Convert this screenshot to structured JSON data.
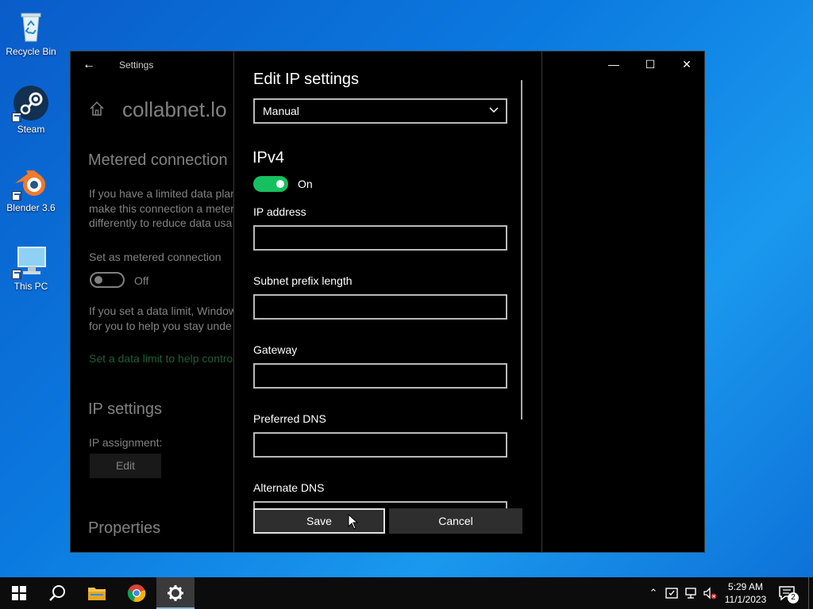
{
  "desktop": {
    "icons": [
      {
        "label": "Recycle Bin",
        "icon": "recycle-bin-icon"
      },
      {
        "label": "Steam",
        "icon": "steam-icon"
      },
      {
        "label": "Blender 3.6",
        "icon": "blender-icon"
      },
      {
        "label": "This PC",
        "icon": "computer-icon"
      }
    ]
  },
  "window": {
    "app_title": "Settings",
    "controls": {
      "minimize": "—",
      "maximize": "☐",
      "close": "✕"
    }
  },
  "background_page": {
    "heading": "collabnet.lo",
    "metered": {
      "heading": "Metered connection",
      "desc_lines": [
        "If you have a limited data plan",
        "make this connection a metere",
        "differently to reduce data usa"
      ],
      "set_label": "Set as metered connection",
      "toggle_state": "Off",
      "limit_lines": [
        "If you set a data limit, Window",
        "for you to help you stay unde"
      ],
      "link": "Set a data limit to help contro"
    },
    "ip_settings": {
      "heading": "IP settings",
      "assignment_label": "IP assignment:",
      "edit_button": "Edit"
    },
    "properties_heading": "Properties"
  },
  "dialog": {
    "title": "Edit IP settings",
    "mode_dropdown": {
      "selected": "Manual"
    },
    "ipv4": {
      "heading": "IPv4",
      "toggle_state": "On",
      "fields": [
        {
          "label": "IP address",
          "value": ""
        },
        {
          "label": "Subnet prefix length",
          "value": ""
        },
        {
          "label": "Gateway",
          "value": ""
        },
        {
          "label": "Preferred DNS",
          "value": ""
        },
        {
          "label": "Alternate DNS",
          "value": ""
        }
      ]
    },
    "buttons": {
      "save": "Save",
      "cancel": "Cancel"
    }
  },
  "taskbar": {
    "pinned": [
      "start-icon",
      "search-icon",
      "file-explorer-icon",
      "chrome-icon",
      "settings-icon"
    ],
    "active": "settings-icon",
    "clock": {
      "time": "5:29 AM",
      "date": "11/1/2023"
    },
    "notification_count": "2"
  },
  "colors": {
    "toggle_on": "#16c060",
    "link": "#3fb96b",
    "desktop": "#0b7ae0"
  }
}
